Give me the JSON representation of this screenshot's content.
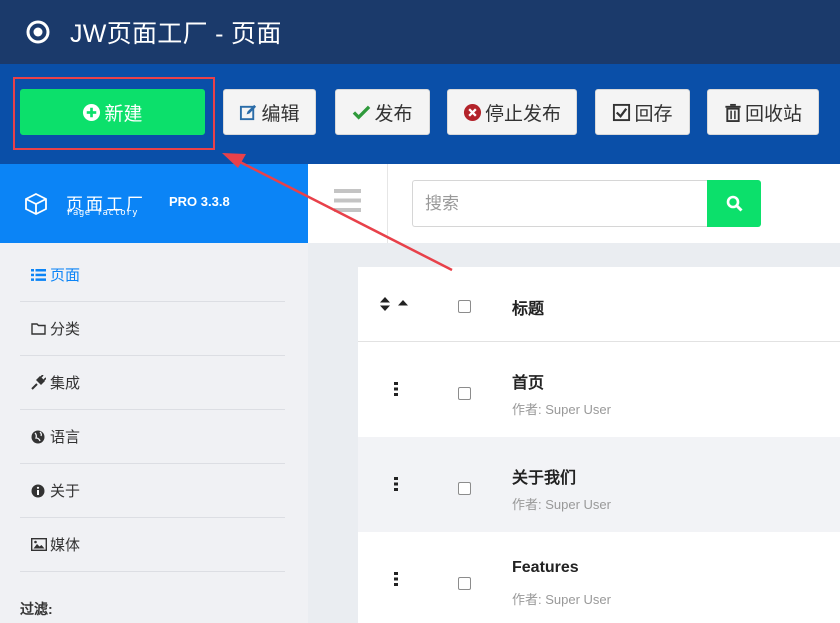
{
  "window": {
    "title": "JW页面工厂 - 页面"
  },
  "toolbar": {
    "new_label": "新建",
    "edit_label": "编辑",
    "publish_label": "发布",
    "unpublish_label": "停止发布",
    "archive_label": "回存",
    "trash_label": "回收站"
  },
  "brand": {
    "name": "页面工厂",
    "subtitle": "Page factory",
    "version": "PRO 3.3.8"
  },
  "sidebar": {
    "items": [
      {
        "label": "页面",
        "icon": "list-icon",
        "active": true
      },
      {
        "label": "分类",
        "icon": "folder-icon"
      },
      {
        "label": "集成",
        "icon": "plug-icon"
      },
      {
        "label": "语言",
        "icon": "globe-icon"
      },
      {
        "label": "关于",
        "icon": "info-icon"
      },
      {
        "label": "媒体",
        "icon": "image-icon"
      }
    ],
    "filter_label": "过滤:"
  },
  "search": {
    "placeholder": "搜索",
    "value": ""
  },
  "table": {
    "header_title": "标题",
    "rows": [
      {
        "title": "首页",
        "author": "作者: Super User"
      },
      {
        "title": "关于我们",
        "author": "作者: Super User"
      },
      {
        "title": "Features",
        "author": "作者: Super User"
      }
    ]
  },
  "colors": {
    "titlebar": "#1b3a6b",
    "toolbar": "#0a4fa8",
    "brand": "#0b84f6",
    "accent_green": "#0ce06b",
    "highlight_red": "#e8414a"
  }
}
